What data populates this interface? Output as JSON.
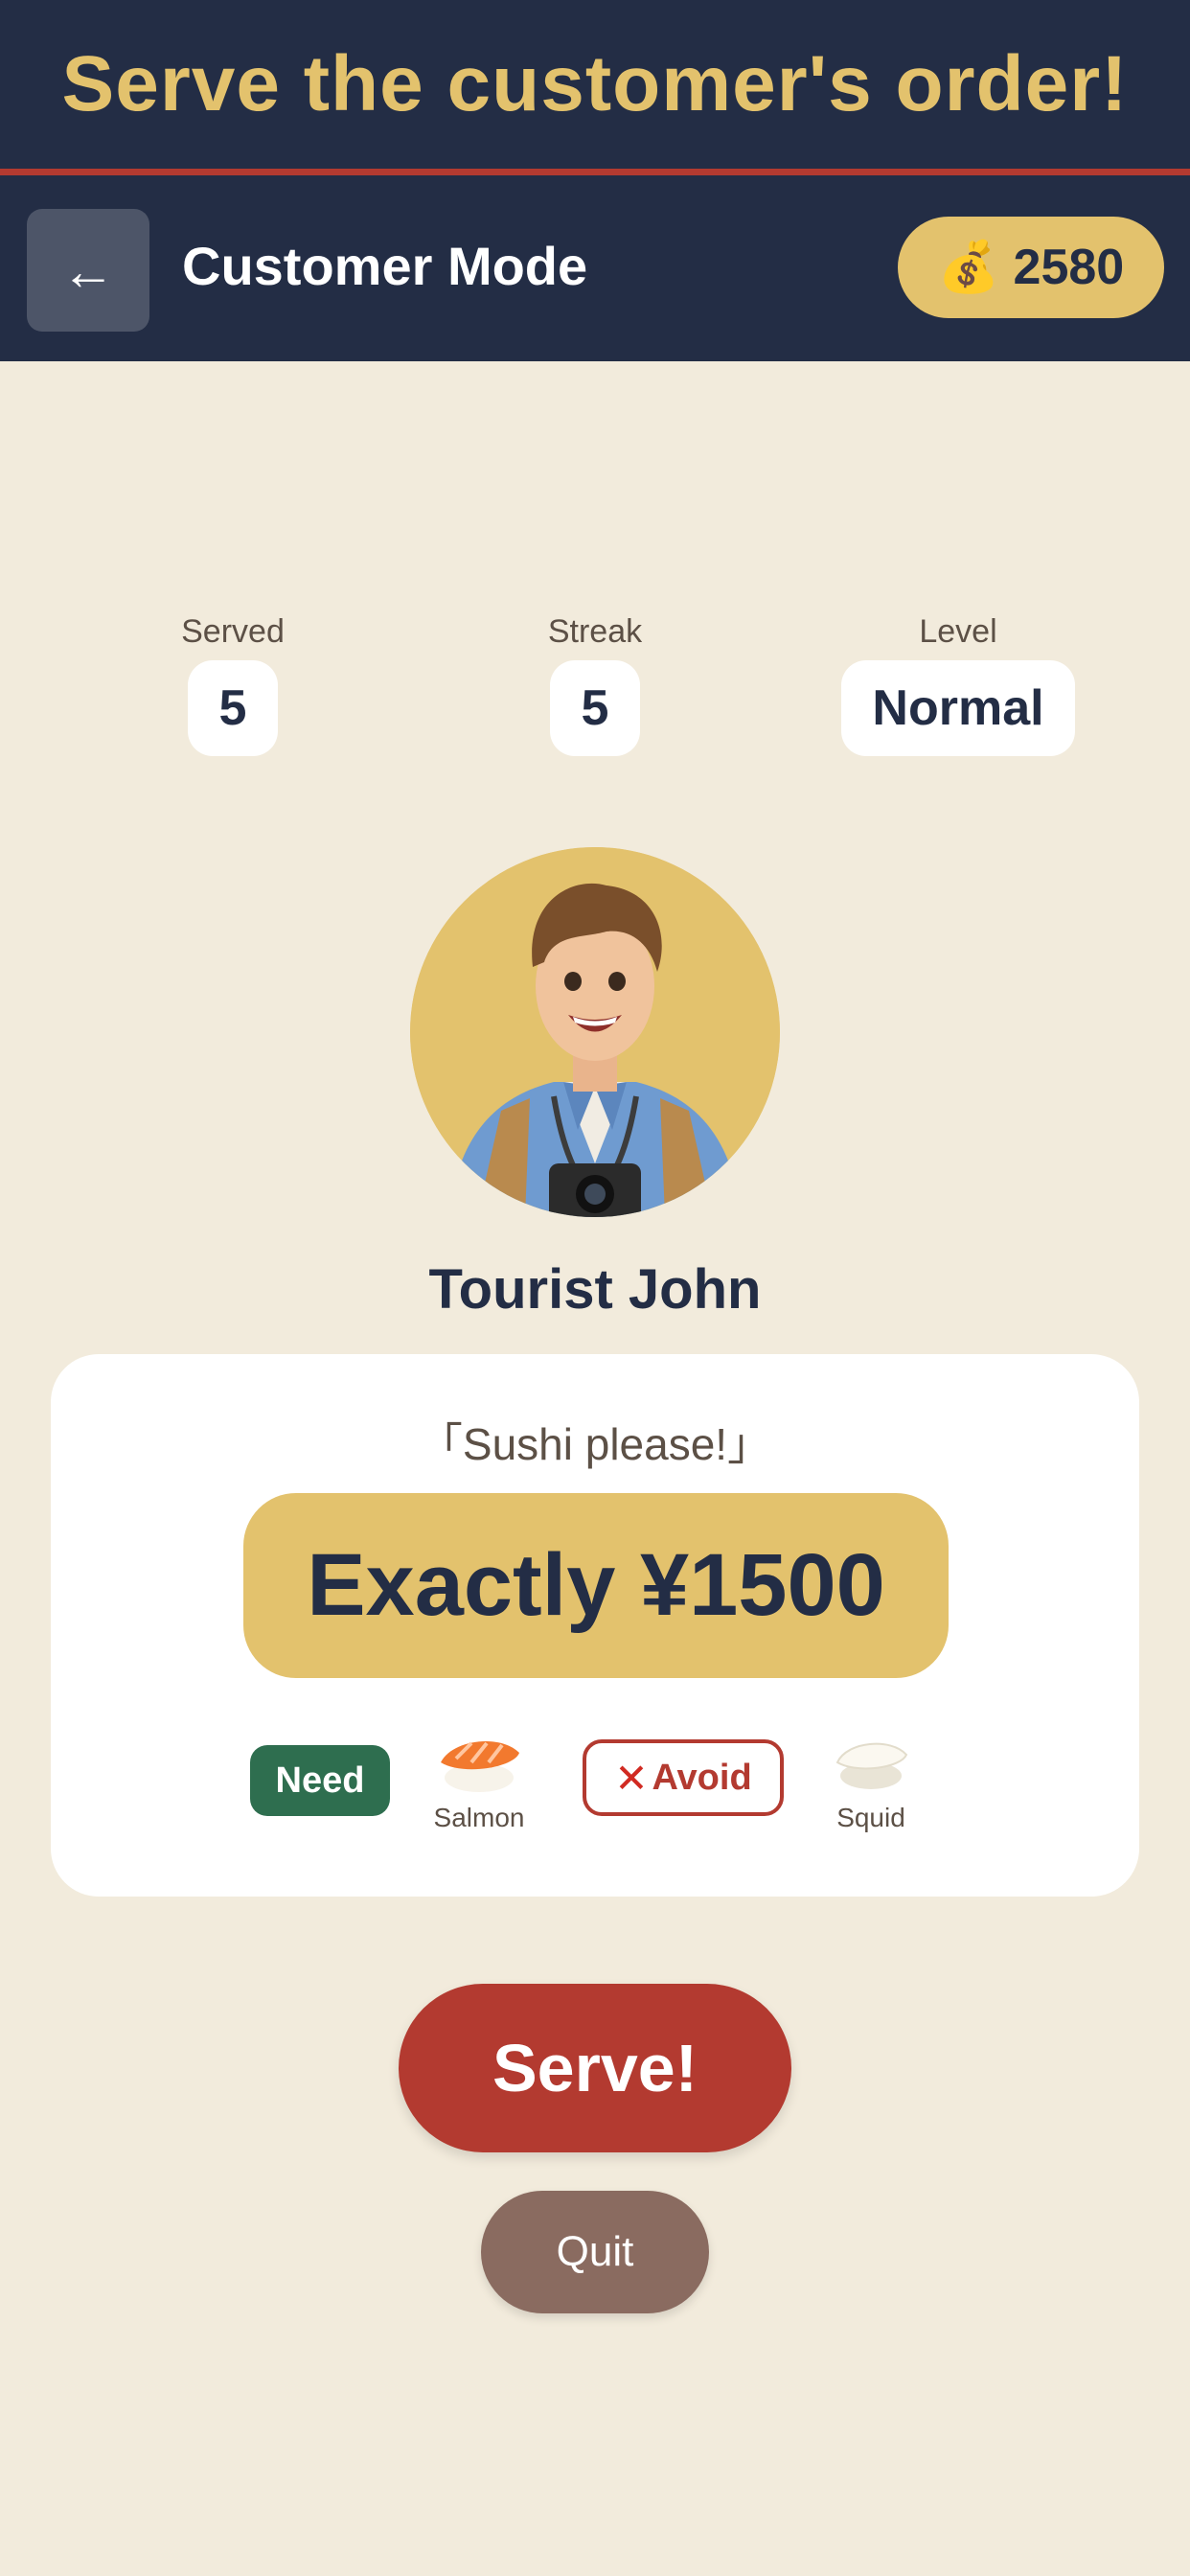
{
  "banner": {
    "title": "Serve the customer's order!"
  },
  "header": {
    "back_label": "←",
    "mode_title": "Customer Mode",
    "coins": "2580",
    "coin_icon": "money-bag-icon"
  },
  "stats": [
    {
      "label": "Served",
      "value": "5"
    },
    {
      "label": "Streak",
      "value": "5"
    },
    {
      "label": "Level",
      "value": "Normal"
    }
  ],
  "customer": {
    "name": "Tourist John",
    "speech": "「Sushi please!」"
  },
  "order": {
    "price_text": "Exactly ¥1500",
    "need_label": "Need",
    "need_item": {
      "name": "Salmon",
      "icon": "salmon-nigiri-icon"
    },
    "avoid_label": "Avoid",
    "avoid_icon": "cross-mark-icon",
    "avoid_item": {
      "name": "Squid",
      "icon": "squid-nigiri-icon"
    }
  },
  "actions": {
    "serve_label": "Serve!",
    "quit_label": "Quit"
  },
  "colors": {
    "navy": "#232d45",
    "gold": "#e3c26d",
    "red": "#b33a30",
    "green": "#2e6e4f",
    "background": "#f2ebdc",
    "quit_brown": "#8a6b60"
  }
}
